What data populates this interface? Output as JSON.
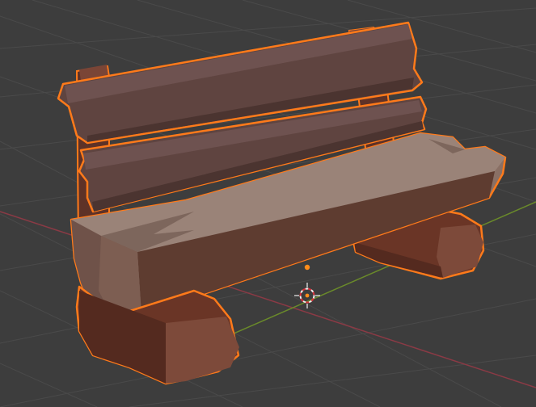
{
  "viewport": {
    "object": "bench",
    "selected": true,
    "colors": {
      "background": "#3d3d3d",
      "grid": "#4a4a4a",
      "axis_x": "#8b3a45",
      "axis_y": "#6a8a2a",
      "selection_outline": "#ff7a1a",
      "wood_light": "#9a8378",
      "wood_mid": "#6f5249",
      "wood_dark": "#4a2c24",
      "leg": "#6a3526",
      "origin": "#ff8c1a",
      "cursor_red": "#d8323c",
      "cursor_white": "#f0f0f0"
    },
    "icons": [
      "3d-cursor-icon",
      "object-origin-icon"
    ]
  }
}
